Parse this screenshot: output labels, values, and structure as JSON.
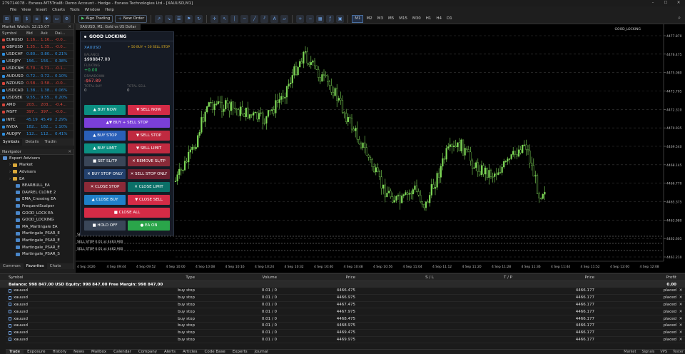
{
  "window": {
    "title": "279714078 - Exness-MT5Trial8: Demo Account - Hedge - Exness Technologies Ltd - [XAUUSD,M1]"
  },
  "menu": [
    "File",
    "View",
    "Insert",
    "Charts",
    "Tools",
    "Window",
    "Help"
  ],
  "toolbar": {
    "algo_trading": "Algo Trading",
    "new_order": "New Order",
    "timeframes": [
      "M1",
      "M2",
      "M3",
      "M5",
      "M15",
      "M30",
      "H1",
      "H4",
      "D1"
    ],
    "active_tf": "M1"
  },
  "market_watch": {
    "title": "Market Watch: 12:15:07",
    "columns": [
      "Symbol",
      "Bid",
      "Ask",
      "Dai..."
    ],
    "rows": [
      {
        "symbol": "EURUSD",
        "bid": "1.16...",
        "ask": "1.16...",
        "daily": "-0.0...",
        "dir": "down"
      },
      {
        "symbol": "GBPUSD",
        "bid": "1.35...",
        "ask": "1.35...",
        "daily": "-0.0...",
        "dir": "down"
      },
      {
        "symbol": "USDCHF",
        "bid": "0.80...",
        "ask": "0.80...",
        "daily": "0.21%",
        "dir": "up"
      },
      {
        "symbol": "USDJPY",
        "bid": "156...",
        "ask": "156...",
        "daily": "0.38%",
        "dir": "up"
      },
      {
        "symbol": "USDCNH",
        "bid": "6.70...",
        "ask": "6.71...",
        "daily": "-0.1...",
        "dir": "down"
      },
      {
        "symbol": "AUDUSD",
        "bid": "0.72...",
        "ask": "0.72...",
        "daily": "0.10%",
        "dir": "up"
      },
      {
        "symbol": "NZDUSD",
        "bid": "0.58...",
        "ask": "0.58...",
        "daily": "-0.0...",
        "dir": "down"
      },
      {
        "symbol": "USDCAD",
        "bid": "1.38...",
        "ask": "1.38...",
        "daily": "0.06%",
        "dir": "up"
      },
      {
        "symbol": "USDSEK",
        "bid": "9.55...",
        "ask": "9.55...",
        "daily": "0.20%",
        "dir": "up"
      },
      {
        "symbol": "AMD",
        "bid": "203...",
        "ask": "203...",
        "daily": "-0.4...",
        "dir": "down"
      },
      {
        "symbol": "MSFT",
        "bid": "397...",
        "ask": "397...",
        "daily": "-0.0...",
        "dir": "down"
      },
      {
        "symbol": "INTC",
        "bid": "45.19",
        "ask": "45.49",
        "daily": "2.29%",
        "dir": "up"
      },
      {
        "symbol": "NVDA",
        "bid": "182...",
        "ask": "182...",
        "daily": "1.10%",
        "dir": "up"
      },
      {
        "symbol": "AUDJPY",
        "bid": "112...",
        "ask": "112...",
        "daily": "0.41%",
        "dir": "up"
      }
    ],
    "tabs": [
      "Symbols",
      "Details",
      "Tradin"
    ]
  },
  "navigator": {
    "title": "Navigator",
    "items": [
      {
        "label": "Expert Advisors",
        "depth": 0,
        "kind": "root"
      },
      {
        "label": "Market",
        "depth": 1,
        "kind": "folder"
      },
      {
        "label": "Advisors",
        "depth": 1,
        "kind": "folder"
      },
      {
        "label": "EA",
        "depth": 1,
        "kind": "folder"
      },
      {
        "label": "BEARBULL_EA",
        "depth": 2,
        "kind": "ea"
      },
      {
        "label": "DAVREL CLONE 2",
        "depth": 2,
        "kind": "ea"
      },
      {
        "label": "EMA_Crossing EA",
        "depth": 2,
        "kind": "ea"
      },
      {
        "label": "FrequentScalper",
        "depth": 2,
        "kind": "ea"
      },
      {
        "label": "GOOD_LOCK EA",
        "depth": 2,
        "kind": "ea"
      },
      {
        "label": "GOOD_LOCKING",
        "depth": 2,
        "kind": "ea"
      },
      {
        "label": "MA_Martingale EA",
        "depth": 2,
        "kind": "ea"
      },
      {
        "label": "Martingale_PSAR_E",
        "depth": 2,
        "kind": "ea"
      },
      {
        "label": "Martingale_PSAR_E",
        "depth": 2,
        "kind": "ea"
      },
      {
        "label": "Martingale_PSAR_E",
        "depth": 2,
        "kind": "ea"
      },
      {
        "label": "Martingale_PSAR_S",
        "depth": 2,
        "kind": "ea"
      }
    ],
    "tabs": [
      "Common",
      "Favorites",
      "Chats"
    ]
  },
  "chart": {
    "tab": "XAUUSD, M1: Gold vs US Dollar",
    "corner": "GOOD_LOCKING",
    "price_labels": [
      "4477.870",
      "4476.475",
      "4475.080",
      "4473.705",
      "4472.310",
      "4470.935",
      "4469.540",
      "4468.145",
      "4466.770",
      "4465.375",
      "4463.980",
      "4462.605",
      "4461.210"
    ],
    "time_labels": [
      "4 Sep 2026",
      "4 Sep 09:44",
      "4 Sep 09:52",
      "4 Sep 10:00",
      "4 Sep 10:08",
      "4 Sep 10:16",
      "4 Sep 10:24",
      "4 Sep 10:32",
      "4 Sep 10:40",
      "4 Sep 10:48",
      "4 Sep 10:56",
      "4 Sep 11:04",
      "4 Sep 11:12",
      "4 Sep 11:20",
      "4 Sep 11:28",
      "4 Sep 11:36",
      "4 Sep 11:44",
      "4 Sep 11:52",
      "4 Sep 12:00",
      "4 Sep 12:08"
    ],
    "stop_labels": [
      "SELL STOP 0.01 at 4464.900",
      "SELL STOP 0.01 at 4463.900",
      "SELL STOP 0.01 at 4462.900"
    ]
  },
  "ea_panel": {
    "title": "GOOD LOCKING",
    "symbol": "XAUUSD",
    "mode": "+ 50 BUY + 50 SELL STOP",
    "balance_label": "BALANCE",
    "balance": "$998847.00",
    "floating_label": "FLOATING",
    "floating": "+0.00",
    "drawdown_label": "DRAWDOWN",
    "drawdown": "-$67.89",
    "total_buy_label": "TOTAL BUY",
    "total_buy": "0",
    "total_sell_label": "TOTAL SELL",
    "total_sell": "0",
    "buttons": {
      "buy_now": "▲ BUY NOW",
      "sell_now": "▼ SELL NOW",
      "buy_sell_stop": "▲▼ BUY + SELL STOP",
      "buy_stop": "▲ BUY STOP",
      "sell_stop": "▼ SELL STOP",
      "buy_limit": "▲ BUY LIMIT",
      "sell_limit": "▼ SELL LIMIT",
      "set_sltp": "■ SET SL/TP",
      "remove_sltp": "✕ REMOVE SL/TP",
      "buy_stop_only": "✕ BUY STOP ONLY",
      "sell_stop_only": "✕ SELL STOP ONLY",
      "close_stop": "✕ CLOSE STOP",
      "close_limit": "✕ CLOSE LIMIT",
      "close_buy": "▲ CLOSE BUY",
      "close_sell": "▼ CLOSE SELL",
      "close_all": "■ CLOSE ALL",
      "hold_off": "■ HOLD OFF",
      "ea_on": "● EA ON"
    }
  },
  "trade": {
    "columns": [
      "Symbol",
      "Type",
      "Volume",
      "Price",
      "S / L",
      "T / P",
      "Price",
      "Profit"
    ],
    "balance_line": "Balance: 998 847.00 USD  Equity: 998 847.00  Free Margin: 998 847.00",
    "balance_profit": "0.00",
    "rows": [
      {
        "symbol": "xauusd",
        "type": "buy stop",
        "volume": "0.01 / 0",
        "price": "4466.475",
        "price2": "4466.177",
        "state": "placed"
      },
      {
        "symbol": "xauusd",
        "type": "buy stop",
        "volume": "0.01 / 0",
        "price": "4466.975",
        "price2": "4466.177",
        "state": "placed"
      },
      {
        "symbol": "xauusd",
        "type": "buy stop",
        "volume": "0.01 / 0",
        "price": "4467.475",
        "price2": "4466.177",
        "state": "placed"
      },
      {
        "symbol": "xauusd",
        "type": "buy stop",
        "volume": "0.01 / 0",
        "price": "4467.975",
        "price2": "4466.177",
        "state": "placed"
      },
      {
        "symbol": "xauusd",
        "type": "buy stop",
        "volume": "0.01 / 0",
        "price": "4468.475",
        "price2": "4466.177",
        "state": "placed"
      },
      {
        "symbol": "xauusd",
        "type": "buy stop",
        "volume": "0.01 / 0",
        "price": "4468.975",
        "price2": "4466.177",
        "state": "placed"
      },
      {
        "symbol": "xauusd",
        "type": "buy stop",
        "volume": "0.01 / 0",
        "price": "4469.475",
        "price2": "4466.177",
        "state": "placed"
      },
      {
        "symbol": "xauusd",
        "type": "buy stop",
        "volume": "0.01 / 0",
        "price": "4469.975",
        "price2": "4466.177",
        "state": "placed"
      }
    ],
    "tabs": [
      "Trade",
      "Exposure",
      "History",
      "News",
      "Mailbox",
      "Calendar",
      "Company",
      "Alerts",
      "Articles",
      "Code Base",
      "Experts",
      "Journal"
    ],
    "status": [
      "Market",
      "Signals",
      "VPS",
      "Tester"
    ]
  },
  "colors": {
    "up": "#2d8fe0",
    "down": "#d8443a",
    "candle": "#7ed957",
    "buy": "#0b8f82",
    "sell": "#d42b46",
    "purple": "#7a3fd8",
    "blue": "#2a5fb8",
    "slate": "#3a4658",
    "darkred": "#8a2a38",
    "green": "#2aa54a",
    "red": "#d42b46"
  }
}
